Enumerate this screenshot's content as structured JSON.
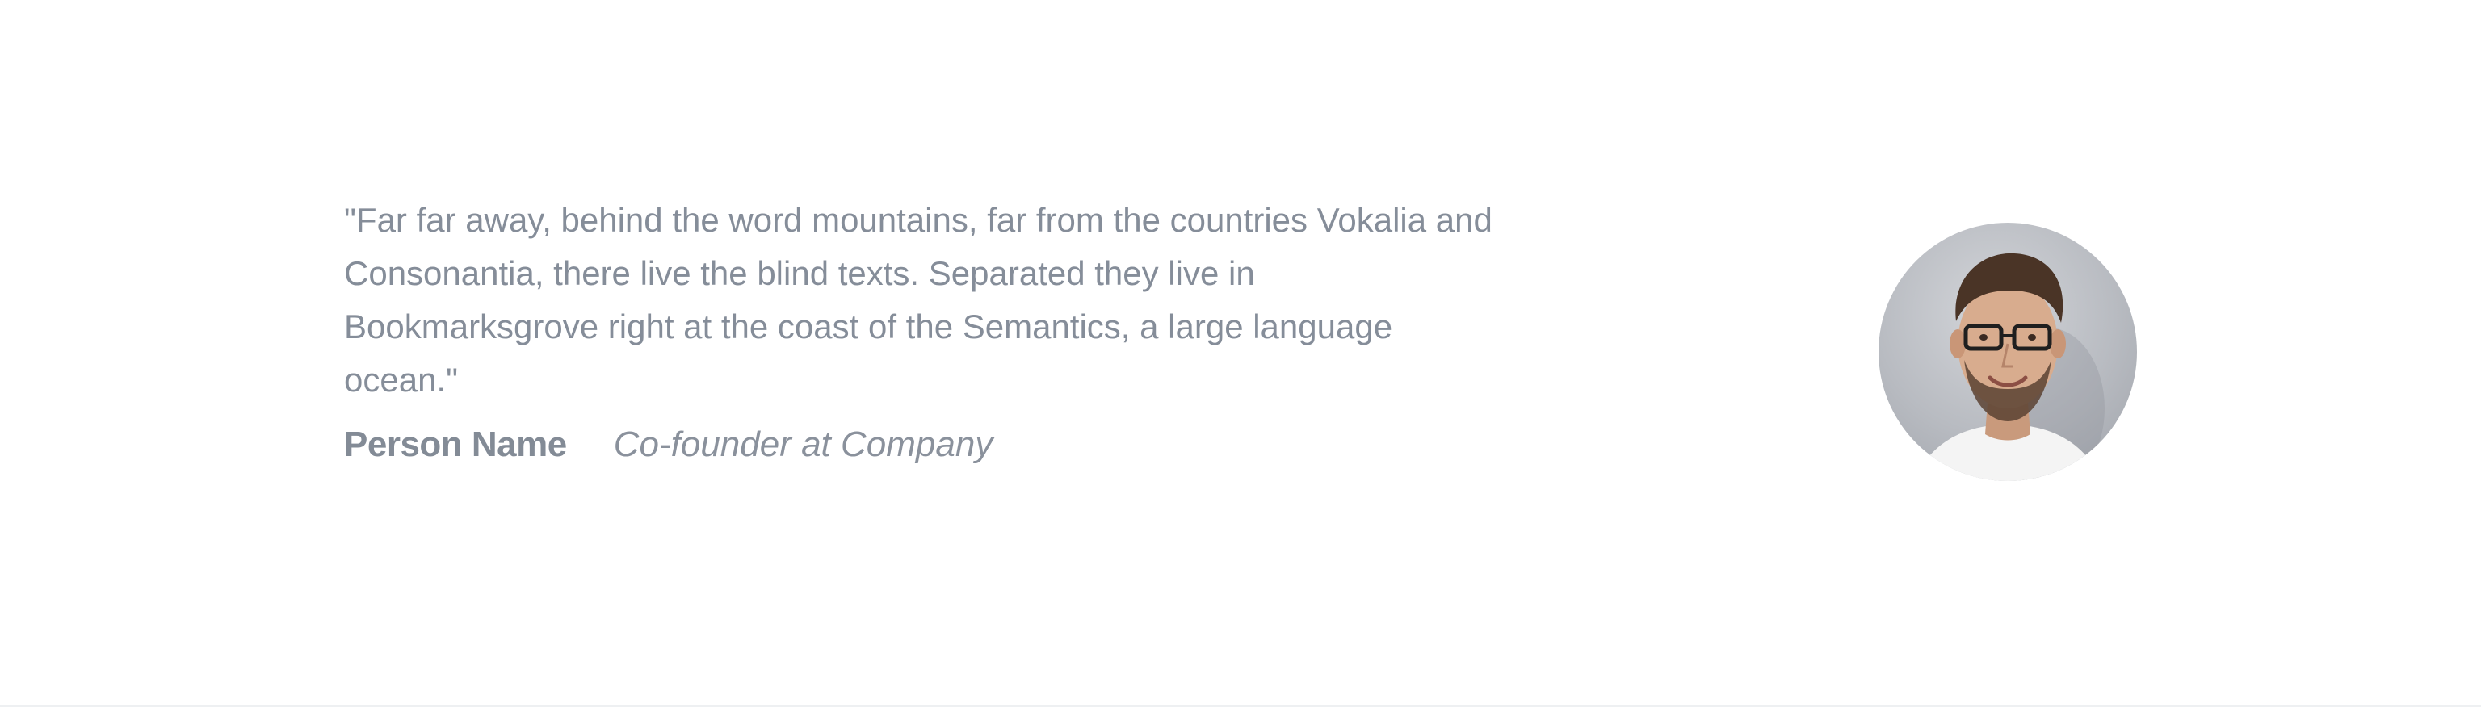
{
  "testimonial": {
    "quote": "\"Far far away, behind the word mountains, far from the countries Vokalia and Consonantia, there live the blind texts. Separated they live in Bookmarksgrove right at the coast of the Semantics, a large language ocean.\"",
    "person_name": "Person Name",
    "person_role": "Co-founder at Company"
  },
  "colors": {
    "text": "#858d99",
    "background": "#ffffff"
  },
  "icons": {
    "avatar": "person-photo-avatar"
  }
}
